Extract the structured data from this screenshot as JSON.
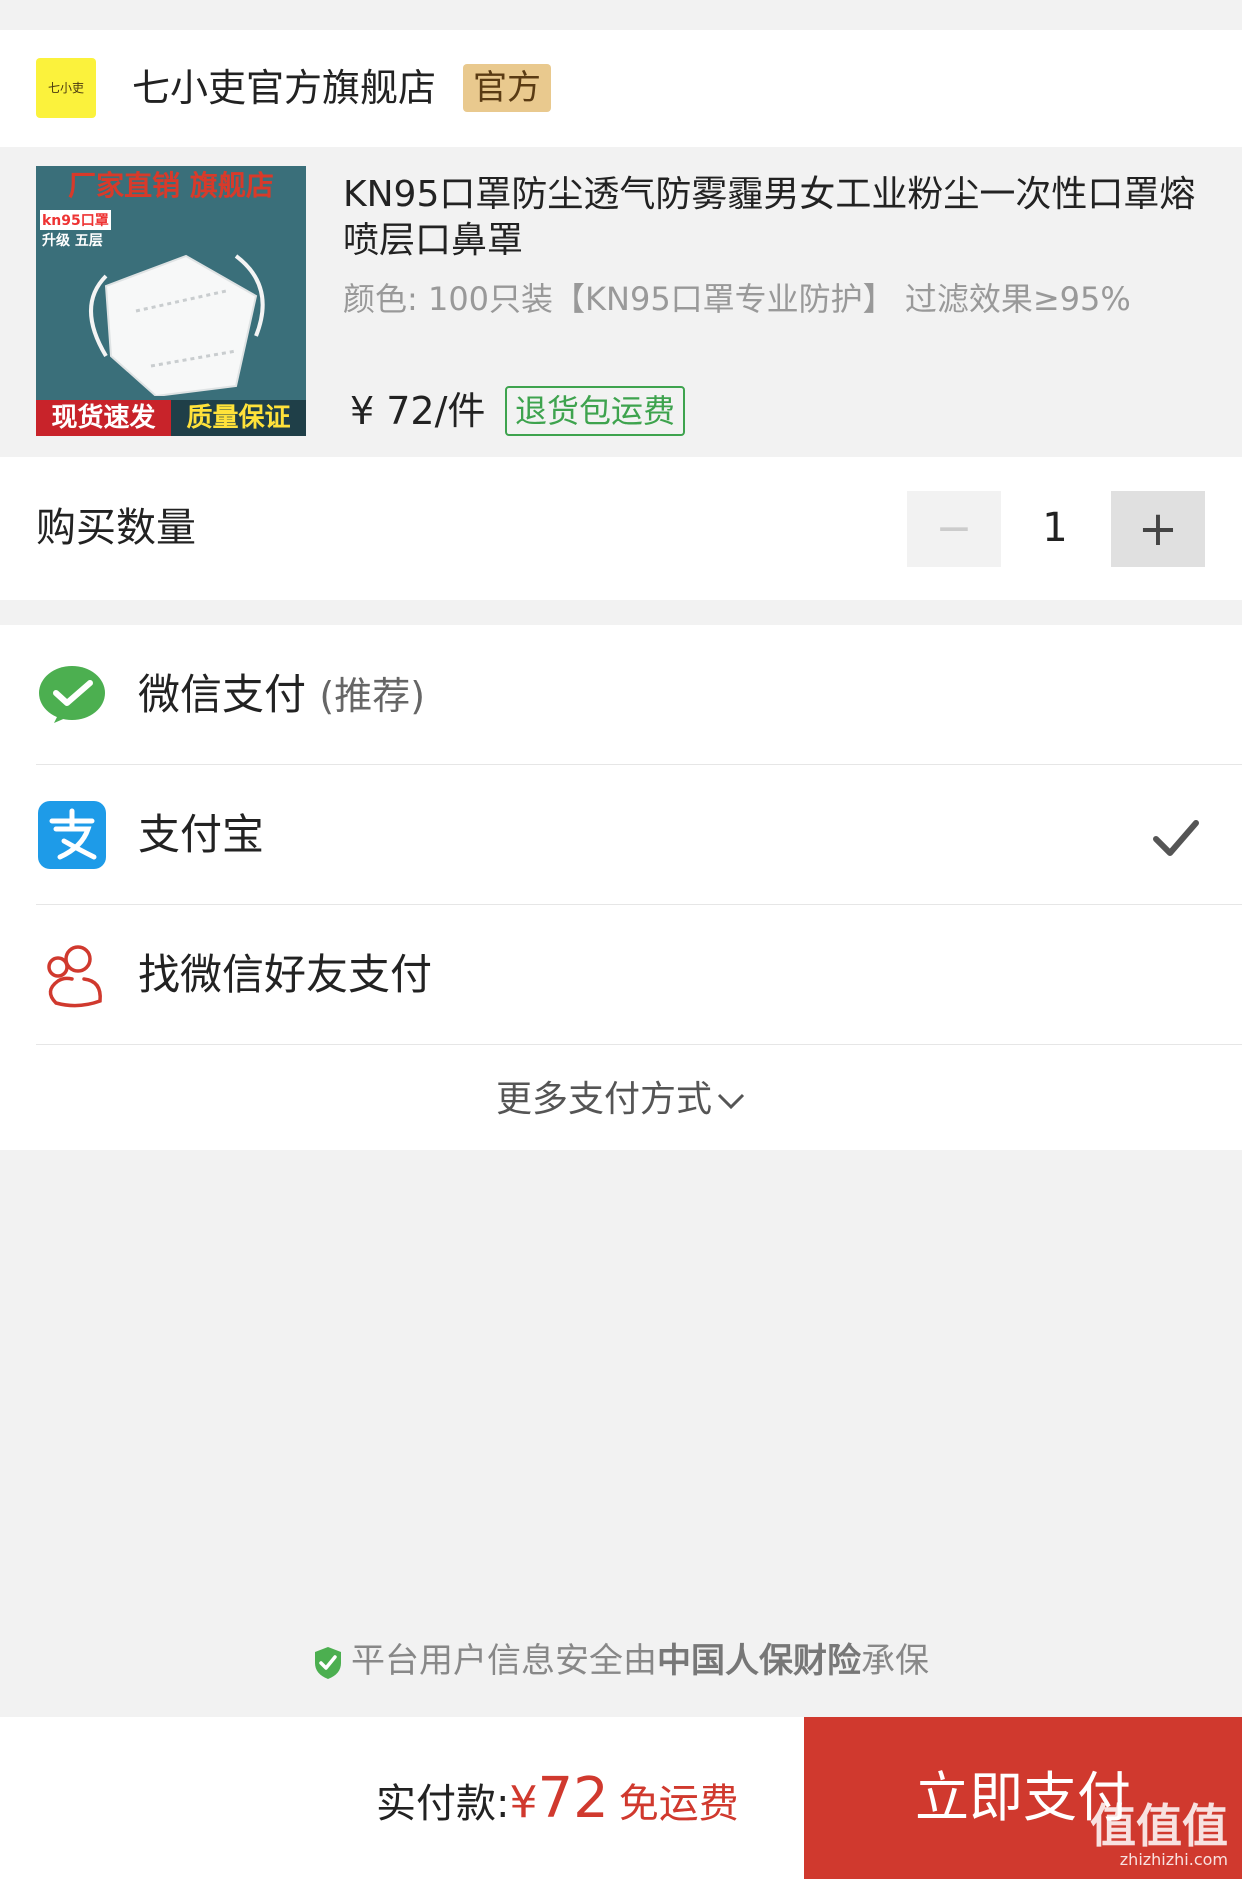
{
  "store": {
    "logo_text": "七小吏",
    "name": "七小吏官方旗舰店",
    "badge": "官方"
  },
  "product": {
    "image_texts": {
      "top": "厂家直销 旗舰店",
      "kn": "kn95口罩",
      "upgrade": "升级 五层",
      "bottom_left": "现货速发",
      "bottom_right": "质量保证"
    },
    "title": "KN95口罩防尘透气防雾霾男女工业粉尘一次性口罩熔喷层口鼻罩",
    "variant": "颜色: 100只装【KN95口罩专业防护】 过滤效果≥95%",
    "price": "¥ 72/件",
    "return_badge": "退货包运费"
  },
  "quantity": {
    "label": "购买数量",
    "minus": "−",
    "value": "1",
    "plus": "+"
  },
  "payment": {
    "options": [
      {
        "label": "微信支付",
        "sub": "(推荐)",
        "icon": "wechat-pay-icon",
        "selected": false
      },
      {
        "label": "支付宝",
        "sub": "",
        "icon": "alipay-icon",
        "selected": true
      },
      {
        "label": "找微信好友支付",
        "sub": "",
        "icon": "friend-pay-icon",
        "selected": false
      }
    ],
    "more": "更多支付方式"
  },
  "security": {
    "prefix": "平台用户信息安全由",
    "brand": "中国人保财险",
    "suffix": "承保"
  },
  "summary": {
    "label": "实付款:",
    "currency": "¥",
    "amount": "72",
    "shipping": "免运费"
  },
  "actions": {
    "pay_now": "立即支付"
  },
  "watermark": {
    "main": "值值值",
    "sub": "zhizhizhi.com"
  },
  "colors": {
    "accent_red": "#d0392e",
    "wechat_green": "#4caf50",
    "alipay_blue": "#1e9be8",
    "return_green": "#3ea34e",
    "official_gold": "#e9c98e"
  }
}
